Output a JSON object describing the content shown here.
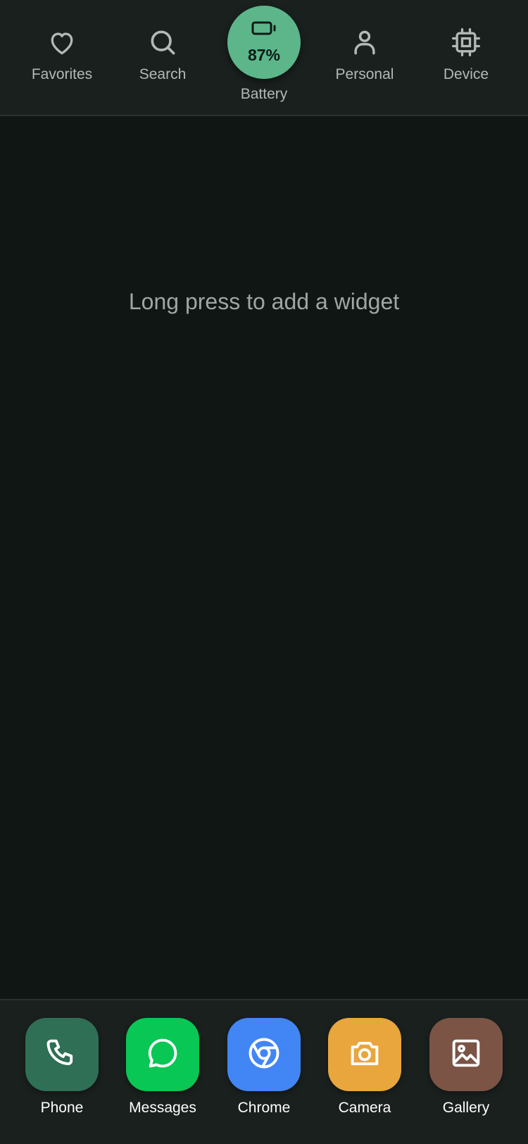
{
  "topbar": {
    "tabs": [
      {
        "label": "Favorites",
        "icon": "heart-icon"
      },
      {
        "label": "Search",
        "icon": "search-icon"
      },
      {
        "label": "Battery",
        "icon": "battery-icon",
        "value": "87%",
        "level": 0.87
      },
      {
        "label": "Personal",
        "icon": "person-icon"
      },
      {
        "label": "Device",
        "icon": "chip-icon"
      }
    ]
  },
  "main": {
    "hint": "Long press to add a widget"
  },
  "dock": {
    "apps": [
      {
        "label": "Phone",
        "icon": "phone-icon",
        "color": "#2e6f55"
      },
      {
        "label": "Messages",
        "icon": "chat-bubble-icon",
        "color": "#08c754"
      },
      {
        "label": "Chrome",
        "icon": "chrome-icon",
        "color": "#4285f4"
      },
      {
        "label": "Camera",
        "icon": "camera-icon",
        "color": "#e8a63c"
      },
      {
        "label": "Gallery",
        "icon": "image-icon",
        "color": "#7b5446"
      }
    ]
  },
  "colors": {
    "background": "#101614",
    "bar": "#1a201e",
    "battery_accent": "#5cb68a",
    "label": "#b3b9b6",
    "hint": "#9fa6a3"
  }
}
